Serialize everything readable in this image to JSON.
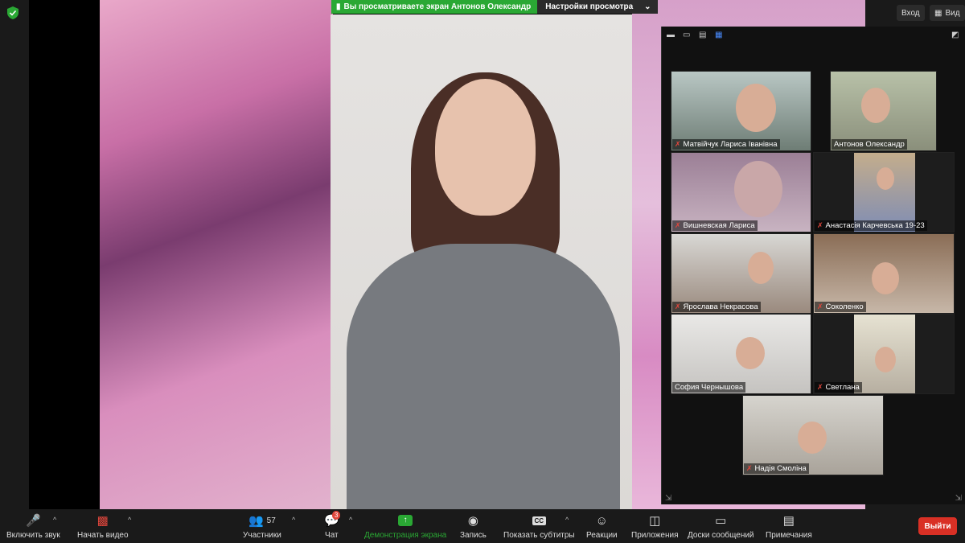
{
  "banner": {
    "viewing_text": "Вы просматриваете экран Антонов Олександр",
    "settings_label": "Настройки просмотра"
  },
  "top_right": {
    "login_label": "Вход",
    "view_label": "Вид"
  },
  "participants": [
    {
      "name": "Матвійчук Лариса Іванівна",
      "muted": true
    },
    {
      "name": "Антонов Олександр",
      "muted": false
    },
    {
      "name": "Вишневская Лариса",
      "muted": true
    },
    {
      "name": "Анастасія Карчевська 19-23",
      "muted": true
    },
    {
      "name": "Ярослава Некрасова",
      "muted": true
    },
    {
      "name": "Соколенко",
      "muted": true
    },
    {
      "name": "София Чернышова",
      "muted": false
    },
    {
      "name": "Светлана",
      "muted": true
    },
    {
      "name": "Надія Смоліна",
      "muted": true
    }
  ],
  "toolbar": {
    "unmute_label": "Включить звук",
    "start_video_label": "Начать видео",
    "participants_label": "Участники",
    "participants_count": "57",
    "chat_label": "Чат",
    "chat_badge": "3",
    "share_label": "Демонстрация экрана",
    "record_label": "Запись",
    "captions_label": "Показать субтитры",
    "reactions_label": "Реакции",
    "apps_label": "Приложения",
    "whiteboards_label": "Доски сообщений",
    "notes_label": "Примечания",
    "leave_label": "Выйти"
  },
  "colors": {
    "share_green": "#2aa834",
    "leave_red": "#d93025",
    "mute_red": "#e0463c"
  }
}
